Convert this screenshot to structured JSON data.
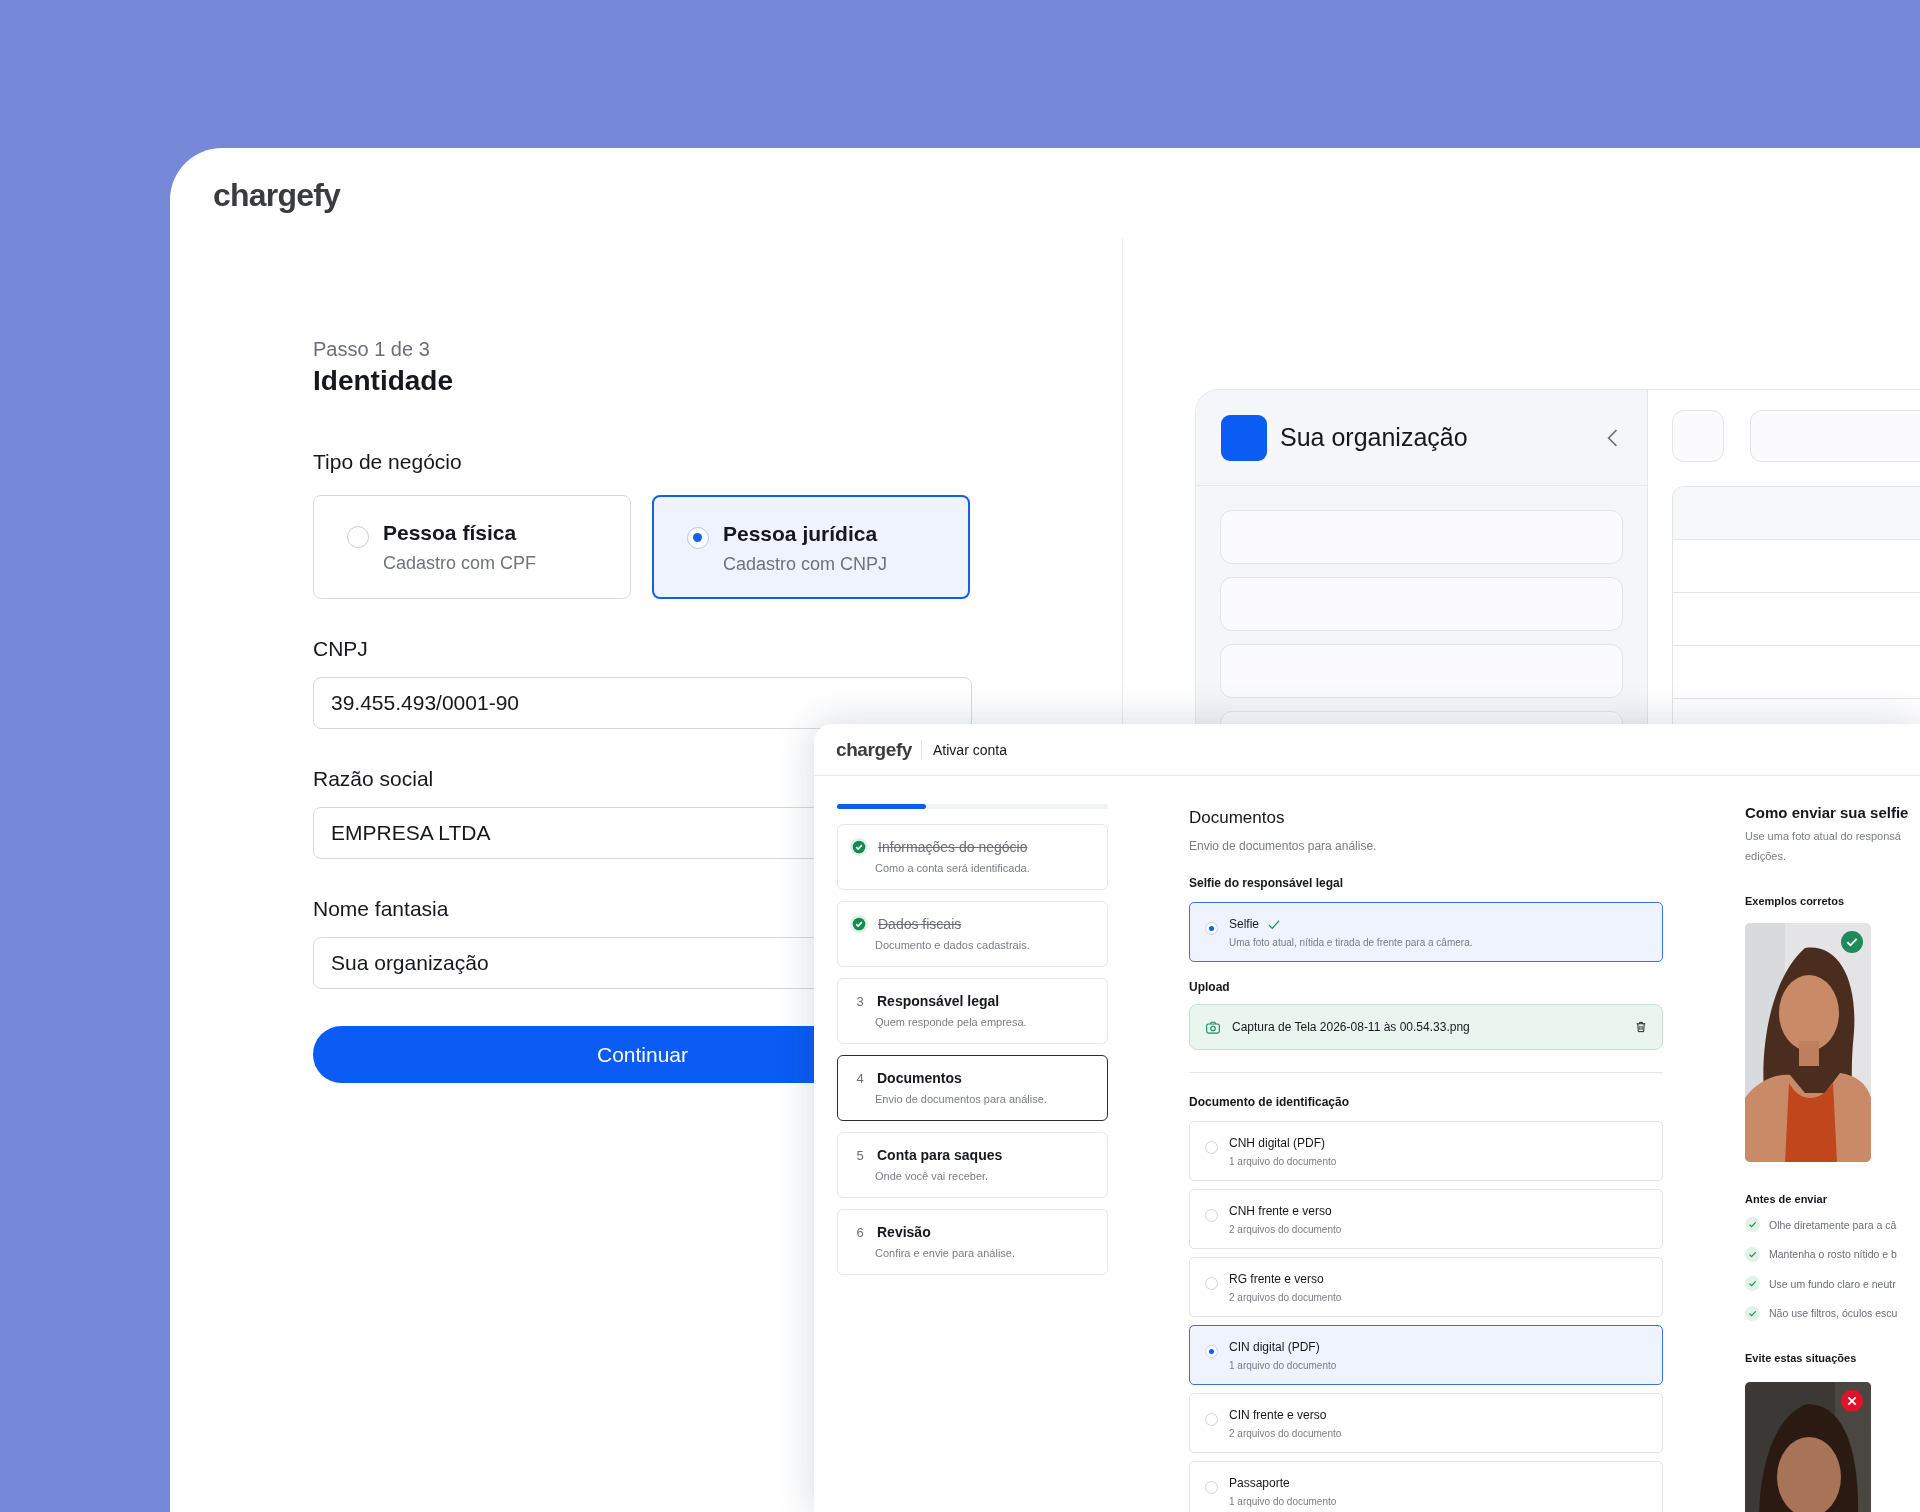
{
  "back_window": {
    "logo": "chargefy",
    "step": "Passo 1 de 3",
    "title": "Identidade",
    "business_type": {
      "label": "Tipo de negócio",
      "options": [
        {
          "title": "Pessoa física",
          "subtitle": "Cadastro com CPF",
          "selected": false
        },
        {
          "title": "Pessoa jurídica",
          "subtitle": "Cadastro com CNPJ",
          "selected": true
        }
      ]
    },
    "fields": [
      {
        "label": "CNPJ",
        "value": "39.455.493/0001-90"
      },
      {
        "label": "Razão social",
        "value": "EMPRESA LTDA"
      },
      {
        "label": "Nome fantasia",
        "value": "Sua organização"
      }
    ],
    "continue_button": "Continuar",
    "preview": {
      "organization_name": "Sua organização"
    }
  },
  "front_window": {
    "logo": "chargefy",
    "title": "Ativar conta",
    "progress": {
      "level": 0.33
    },
    "steps": [
      {
        "title": "Informações do negócio",
        "subtitle": "Como a conta será identificada.",
        "completed": true,
        "selected": false
      },
      {
        "title": "Dados fiscais",
        "subtitle": "Documento e dados cadastrais.",
        "completed": true,
        "selected": false
      },
      {
        "number": "3",
        "title": "Responsável legal",
        "subtitle": "Quem responde pela empresa.",
        "completed": false,
        "selected": false
      },
      {
        "number": "4",
        "title": "Documentos",
        "subtitle": "Envio de documentos para análise.",
        "completed": false,
        "selected": true
      },
      {
        "number": "5",
        "title": "Conta para saques",
        "subtitle": "Onde você vai receber.",
        "completed": false,
        "selected": false
      },
      {
        "number": "6",
        "title": "Revisão",
        "subtitle": "Confira e envie para análise.",
        "completed": false,
        "selected": false
      }
    ],
    "documents": {
      "title": "Documentos",
      "subtitle": "Envio de documentos para análise.",
      "selfie_section": "Selfie do responsável legal",
      "selfie_option": {
        "title": "Selfie",
        "subtitle": "Uma foto atual, nítida e tirada de frente para a câmera.",
        "selected": true,
        "verified": true
      },
      "upload_label": "Upload",
      "upload_file": "Captura de Tela 2026-08-11 às 00.54.33.png",
      "id_section": "Documento de identificação",
      "id_options": [
        {
          "title": "CNH digital (PDF)",
          "subtitle": "1 arquivo do documento",
          "selected": false
        },
        {
          "title": "CNH frente e verso",
          "subtitle": "2 arquivos do documento",
          "selected": false
        },
        {
          "title": "RG frente e verso",
          "subtitle": "2 arquivos do documento",
          "selected": false
        },
        {
          "title": "CIN digital (PDF)",
          "subtitle": "1 arquivo do documento",
          "selected": true
        },
        {
          "title": "CIN frente e verso",
          "subtitle": "2 arquivos do documento",
          "selected": false
        },
        {
          "title": "Passaporte",
          "subtitle": "1 arquivo do documento",
          "selected": false
        }
      ]
    },
    "guide": {
      "title": "Como enviar sua selfie",
      "description_lines": [
        "Use uma foto atual do responsá",
        "edições."
      ],
      "correct_label": "Exemplos corretos",
      "checklist_title": "Antes de enviar",
      "checklist": [
        "Olhe diretamente para a câ",
        "Mantenha o rosto nítido e b",
        "Use um fundo claro e neutr",
        "Não use filtros, óculos escu"
      ],
      "avoid_label": "Evite estas situações"
    }
  }
}
